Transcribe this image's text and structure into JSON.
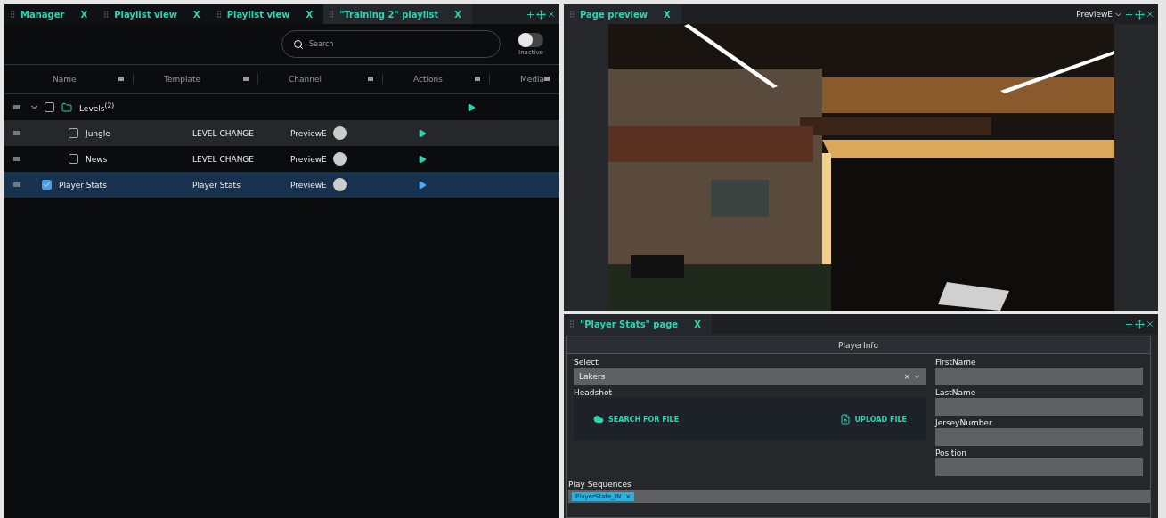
{
  "left_panel": {
    "tabs": [
      {
        "label": "Manager",
        "close": "X",
        "selected": false
      },
      {
        "label": "Playlist view",
        "close": "X",
        "selected": false
      },
      {
        "label": "Playlist view",
        "close": "X",
        "selected": false
      },
      {
        "label": "\"Training 2\" playlist",
        "close": "X",
        "selected": true
      }
    ],
    "search": {
      "placeholder": "Search"
    },
    "toggle": {
      "label": "Inactive",
      "on": false
    },
    "columns": [
      "Name",
      "Template",
      "Channel",
      "Actions",
      "Media"
    ],
    "rows": [
      {
        "name": "Levels",
        "count": "(2)",
        "kind": "folder",
        "checked": false,
        "expanded": true,
        "selected": false,
        "children": [
          {
            "name": "Jungle",
            "kind": "item",
            "template": "LEVEL CHANGE",
            "channel": "PreviewE",
            "checked": false,
            "selected": false
          },
          {
            "name": "News",
            "kind": "item",
            "template": "LEVEL CHANGE",
            "channel": "PreviewE",
            "checked": false,
            "selected": false
          }
        ]
      },
      {
        "name": "Player Stats",
        "kind": "item",
        "template": "Player Stats",
        "channel": "PreviewE",
        "checked": true,
        "selected": true
      }
    ]
  },
  "preview_panel": {
    "title": "Page preview",
    "close": "X",
    "channel": "PreviewE"
  },
  "page_panel": {
    "title": "\"Player Stats\" page",
    "close": "X",
    "section": "PlayerInfo",
    "select": {
      "label": "Select",
      "value": "Lakers",
      "clear": "×"
    },
    "headshot": {
      "label": "Headshot",
      "search_button": "SEARCH FOR FILE",
      "upload_button": "UPLOAD FILE"
    },
    "fields": [
      {
        "label": "FirstName"
      },
      {
        "label": "LastName"
      },
      {
        "label": "JerseyNumber"
      },
      {
        "label": "Position"
      }
    ],
    "sequences": {
      "label": "Play Sequences",
      "tags": [
        {
          "label": "PlayerState_IN",
          "remove": "×"
        }
      ]
    }
  }
}
